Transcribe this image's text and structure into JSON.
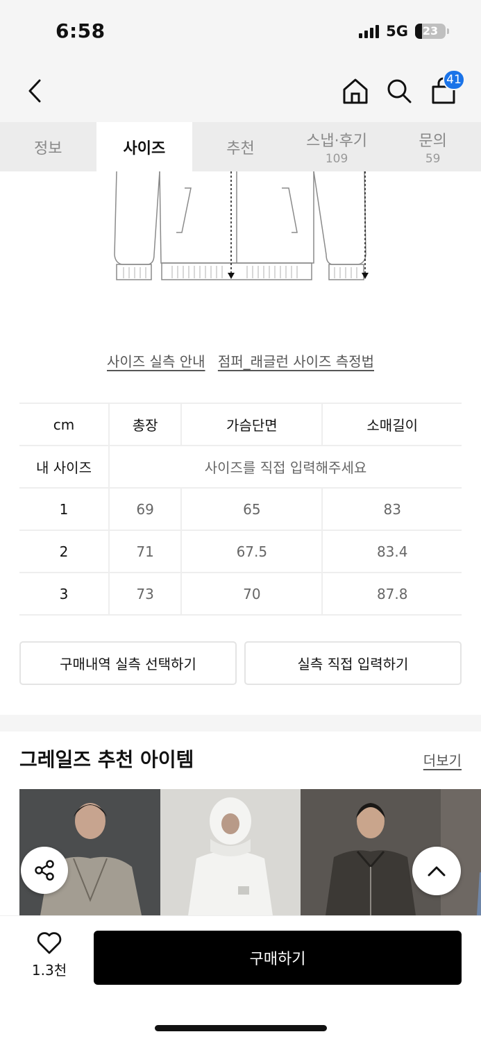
{
  "status": {
    "time": "6:58",
    "network": "5G",
    "battery": "23"
  },
  "header": {
    "cart_count": "41",
    "icons": [
      "chevron-left-icon",
      "home-icon",
      "search-icon",
      "shopping-bag-icon"
    ]
  },
  "tabs": [
    {
      "label": "정보",
      "sub": ""
    },
    {
      "label": "사이즈",
      "sub": ""
    },
    {
      "label": "추천",
      "sub": ""
    },
    {
      "label": "스냅·후기",
      "sub": "109"
    },
    {
      "label": "문의",
      "sub": "59"
    }
  ],
  "guide_links": {
    "link1": "사이즈 실측 안내",
    "link2": "점퍼_래글런 사이즈 측정법"
  },
  "size_table": {
    "headers": [
      "cm",
      "총장",
      "가슴단면",
      "소매길이"
    ],
    "my_size_label": "내 사이즈",
    "my_size_prompt": "사이즈를 직접 입력해주세요",
    "rows": [
      {
        "size": "1",
        "values": [
          "69",
          "65",
          "83"
        ]
      },
      {
        "size": "2",
        "values": [
          "71",
          "67.5",
          "83.4"
        ]
      },
      {
        "size": "3",
        "values": [
          "73",
          "70",
          "87.8"
        ]
      }
    ]
  },
  "actions": {
    "purchase_history": "구매내역 실측 선택하기",
    "manual_input": "실측 직접 입력하기"
  },
  "recommend": {
    "title": "그레일즈 추천 아이템",
    "more": "더보기"
  },
  "bottom": {
    "like_count": "1.3천",
    "buy_label": "구매하기"
  },
  "colors": {
    "accent_badge": "#1a73e8",
    "buy_button": "#000000"
  }
}
